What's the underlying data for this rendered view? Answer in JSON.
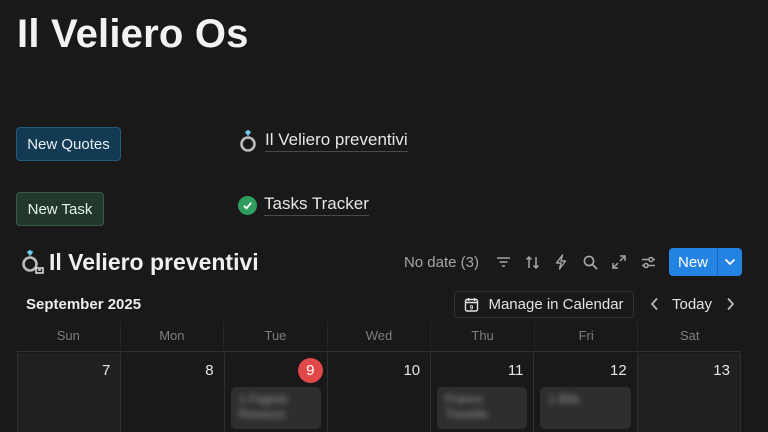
{
  "page": {
    "title": "Il Veliero Os"
  },
  "buttons": {
    "new_quotes": "New Quotes",
    "new_task": "New Task"
  },
  "links": [
    {
      "label": "Il Veliero preventivi",
      "icon": "ring-icon"
    },
    {
      "label": "Tasks Tracker",
      "icon": "check-circle-icon"
    }
  ],
  "database": {
    "title": "Il Veliero preventivi",
    "no_date_label": "No date (3)",
    "new_label": "New",
    "accent_color": "#2383e2"
  },
  "calendar": {
    "month_label": "September 2025",
    "manage_label": "Manage in Calendar",
    "today_label": "Today",
    "weekdays": [
      "Sun",
      "Mon",
      "Tue",
      "Wed",
      "Thu",
      "Fri",
      "Sat"
    ],
    "days": [
      "7",
      "8",
      "9",
      "10",
      "11",
      "12",
      "13"
    ],
    "today_color": "#e0484a",
    "events": [
      {
        "text": "1 Fagiolo Rosazzo"
      },
      {
        "text": "Franco Travella"
      },
      {
        "text": "1 Bifa"
      }
    ]
  }
}
